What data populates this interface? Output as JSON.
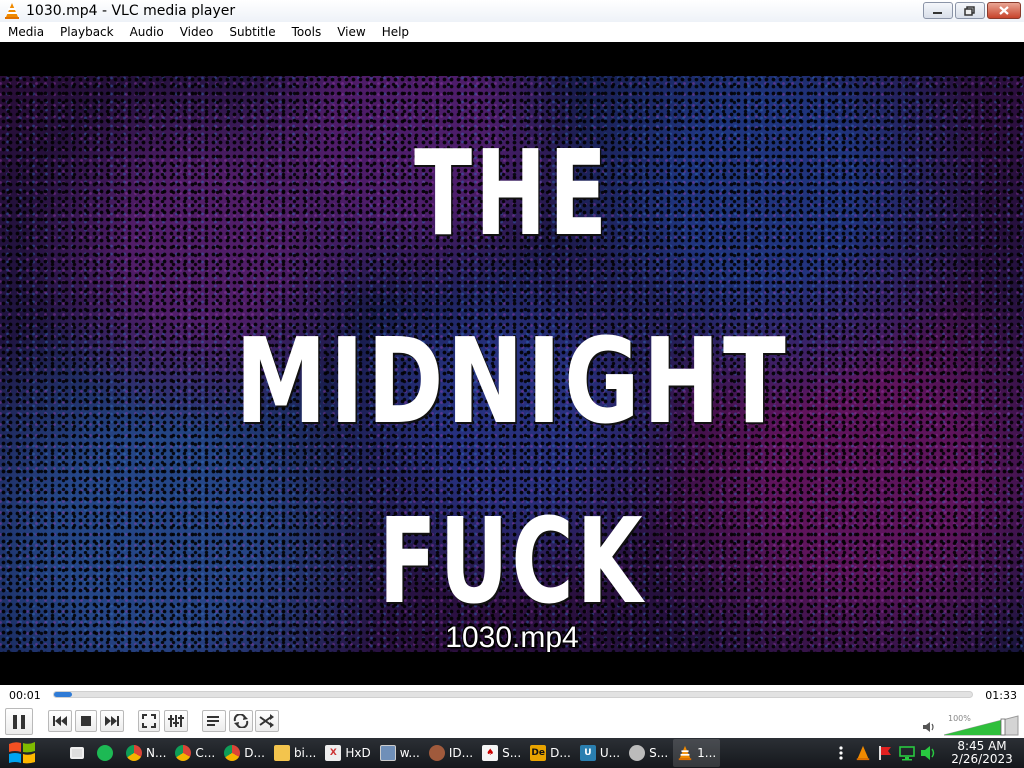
{
  "window": {
    "title": "1030.mp4 - VLC media player",
    "icon": "vlc-cone-icon"
  },
  "menu": [
    "Media",
    "Playback",
    "Audio",
    "Video",
    "Subtitle",
    "Tools",
    "View",
    "Help"
  ],
  "video": {
    "frame_text": [
      "THE",
      "MIDNIGHT",
      "FUCK"
    ],
    "osd_filename": "1030.mp4"
  },
  "playback": {
    "elapsed": "00:01",
    "total": "01:33",
    "progress_fraction": 0.01,
    "volume_label": "100%",
    "volume_fraction": 1.0,
    "accent_color": "#2f7bd6"
  },
  "controls": [
    "pause-icon",
    "previous-icon",
    "stop-icon",
    "next-icon",
    "fullscreen-icon",
    "extended-settings-icon",
    "playlist-icon",
    "loop-icon",
    "shuffle-icon"
  ],
  "taskbar": {
    "tasks": [
      {
        "label": "",
        "icon": "task-view-icon"
      },
      {
        "label": "",
        "icon": "spotify-icon"
      },
      {
        "label": "N...",
        "icon": "chrome-icon"
      },
      {
        "label": "C...",
        "icon": "chrome-icon"
      },
      {
        "label": "D...",
        "icon": "chrome-icon"
      },
      {
        "label": "bi...",
        "icon": "folder-icon"
      },
      {
        "label": "HxD",
        "icon": "hxd-icon"
      },
      {
        "label": "w...",
        "icon": "image-viewer-icon"
      },
      {
        "label": "ID...",
        "icon": "person-icon"
      },
      {
        "label": "S...",
        "icon": "cards-icon"
      },
      {
        "label": "D...",
        "icon": "de-icon"
      },
      {
        "label": "U...",
        "icon": "unity-icon"
      },
      {
        "label": "S...",
        "icon": "settings-icon"
      },
      {
        "label": "1...",
        "icon": "vlc-cone-icon"
      }
    ],
    "clock_time": "8:45 AM",
    "clock_date": "2/26/2023"
  }
}
